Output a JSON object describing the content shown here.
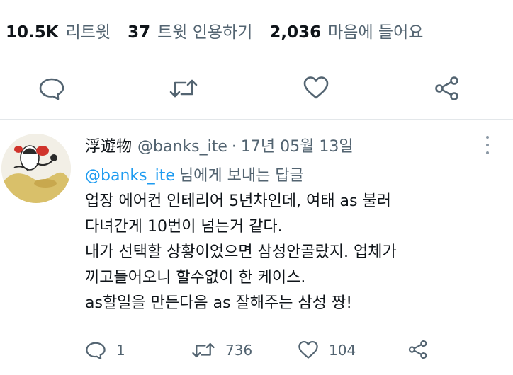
{
  "stats": {
    "retweets": {
      "count": "10.5K",
      "label": "리트윗"
    },
    "quotes": {
      "count": "37",
      "label": "트윗 인용하기"
    },
    "likes": {
      "count": "2,036",
      "label": "마음에 들어요"
    }
  },
  "main_actions": {
    "reply_icon": "reply-icon",
    "retweet_icon": "retweet-icon",
    "like_icon": "heart-icon",
    "share_icon": "share-icon"
  },
  "reply_tweet": {
    "display_name": "浮遊物",
    "handle": "@banks_ite",
    "separator": "·",
    "date": "17년 05월 13일",
    "replying_to": {
      "handle": "@banks_ite",
      "suffix": "님에게 보내는 답글"
    },
    "text_lines": [
      "업장 에어컨 인테리어 5년차인데, 여태 as 불러",
      "다녀간게 10번이 넘는거 같다.",
      "내가 선택할 상황이었으면 삼성안골랐지. 업체가",
      "끼고들어오니 할수없이 한 케이스.",
      "as할일을 만든다음 as 잘해주는 삼성 짱!"
    ],
    "counts": {
      "replies": "1",
      "retweets": "736",
      "likes": "104"
    }
  },
  "colors": {
    "text": "#0f1419",
    "secondary": "#536471",
    "accent": "#1d9bf0",
    "divider": "#e3e7ea"
  }
}
